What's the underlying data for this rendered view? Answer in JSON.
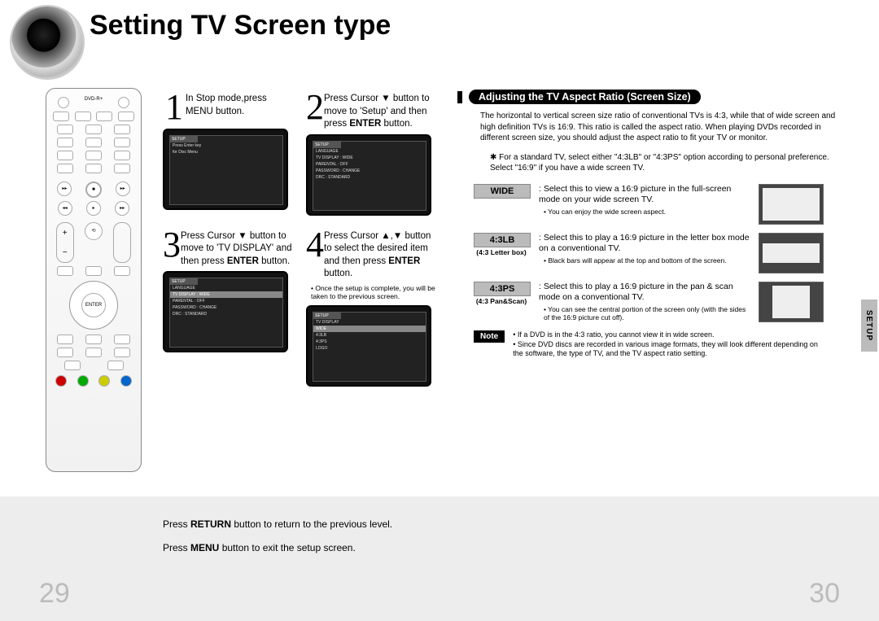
{
  "title": "Setting TV Screen type",
  "side_tab": "SETUP",
  "page_left": "29",
  "page_right": "30",
  "steps": {
    "s1": {
      "num": "1",
      "text": "In Stop mode,press MENU button."
    },
    "s2": {
      "num": "2",
      "text_pre": "Press Cursor ▼ button to move to 'Setup' and then press ",
      "bold": "ENTER",
      "text_post": " button."
    },
    "s3": {
      "num": "3",
      "text_pre": "Press Cursor ▼ button to move to 'TV DISPLAY' and then press ",
      "bold": "ENTER",
      "text_post": " button."
    },
    "s4": {
      "num": "4",
      "text_pre": "Press Cursor ▲,▼ button to select the desired item and then press ",
      "bold": "ENTER",
      "text_post": " button.",
      "foot": "• Once the setup is complete, you will be taken to the previous screen."
    }
  },
  "osd": {
    "hdr": "SETUP",
    "t1a": "Press Enter key",
    "t1b": "for Disc Menu",
    "r1": "LANGUAGE",
    "r2": "TV DISPLAY : WIDE",
    "r3": "PARENTAL : OFF",
    "r4": "PASSWORD : CHANGE",
    "r5": "DRC : STANDARD",
    "d1": "TV DISPLAY",
    "d2": "WIDE",
    "d3": "4:3LB",
    "d4": "4:3PS",
    "d5": "LOGO"
  },
  "right": {
    "heading": "Adjusting the TV Aspect Ratio (Screen Size)",
    "intro": "The horizontal to vertical screen size ratio of conventional TVs is 4:3, while that of wide screen and high definition TVs is 16:9. This ratio is called the aspect ratio. When playing DVDs recorded in different screen size, you should adjust the aspect ratio to fit your TV or monitor.",
    "star": "✱ For a standard TV, select either \"4:3LB\" or \"4:3PS\" option according to personal preference. Select \"16:9\" if you have a wide screen TV.",
    "modes": {
      "wide": {
        "label": "WIDE",
        "sub": "",
        "text": ": Select this to view a 16:9 picture in the full-screen mode on your wide screen TV.",
        "bullet": "• You can enjoy the wide screen aspect."
      },
      "lb": {
        "label": "4:3LB",
        "sub": "(4:3 Letter box)",
        "text": ": Select this to play a 16:9 picture in the letter box mode on a conventional TV.",
        "bullet": "• Black bars will appear at the top and bottom of the screen."
      },
      "ps": {
        "label": "4:3PS",
        "sub": "(4:3 Pan&Scan)",
        "text": ": Select this to play a 16:9 picture in the pan & scan mode on a conventional TV.",
        "bullet": "• You can see the central portion of the screen only (with the sides of the 16:9 picture cut off)."
      }
    },
    "note_label": "Note",
    "note_text": "• If a DVD is in the 4:3 ratio, you cannot view it in wide screen.\n• Since DVD discs are recorded in various image formats, they will look different depending on the software, the type of TV, and the TV aspect ratio setting."
  },
  "bottom": {
    "l1_pre": "Press ",
    "l1_b": "RETURN",
    "l1_post": " button to return to the previous level.",
    "l2_pre": "Press ",
    "l2_b": "MENU",
    "l2_post": " button to exit the setup screen."
  }
}
